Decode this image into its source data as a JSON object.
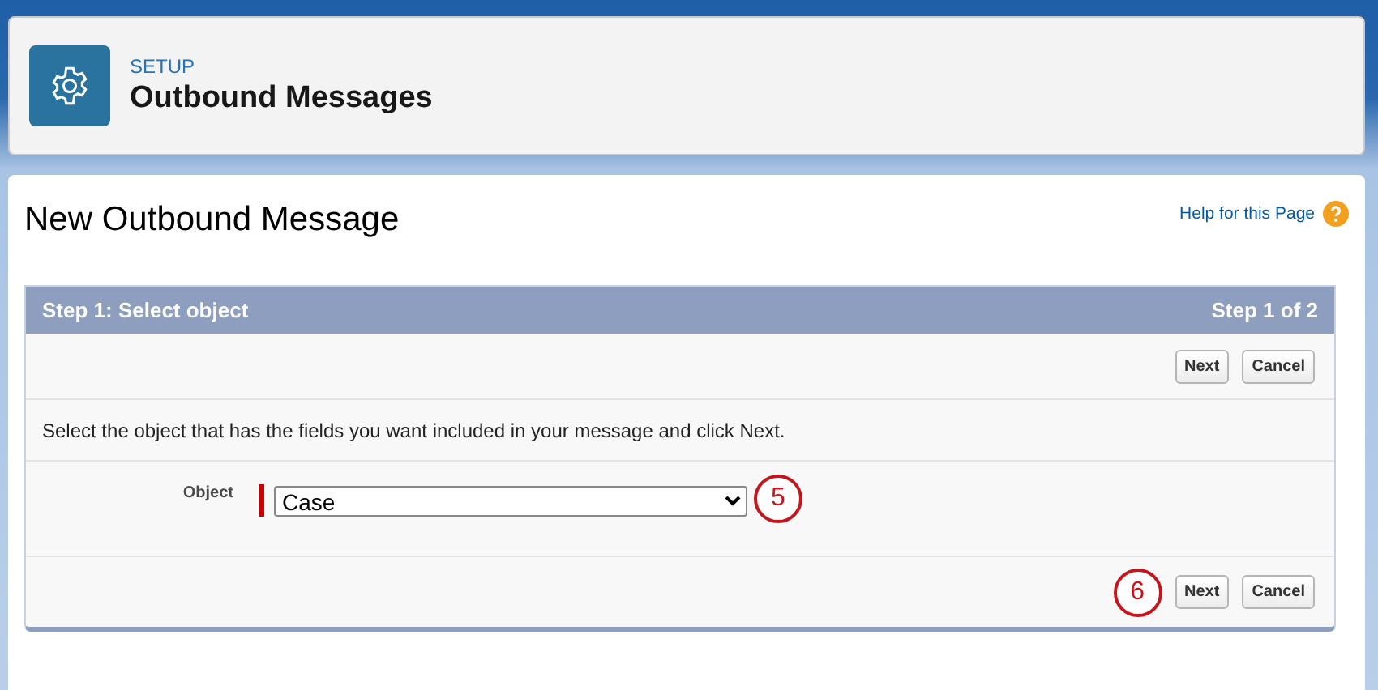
{
  "header": {
    "eyebrow": "SETUP",
    "title": "Outbound Messages"
  },
  "page": {
    "title": "New Outbound Message",
    "help_link": "Help for this Page"
  },
  "section": {
    "title": "Step 1: Select object",
    "step": "Step 1 of 2",
    "top_buttons": [
      "Next",
      "Cancel"
    ],
    "instruction": "Select the object that has the fields you want included in your message and click Next.",
    "field": {
      "label": "Object",
      "value": "Case",
      "required": true,
      "callout": "5"
    },
    "bottom_callout": "6",
    "bottom_buttons": [
      "Next",
      "Cancel"
    ]
  }
}
